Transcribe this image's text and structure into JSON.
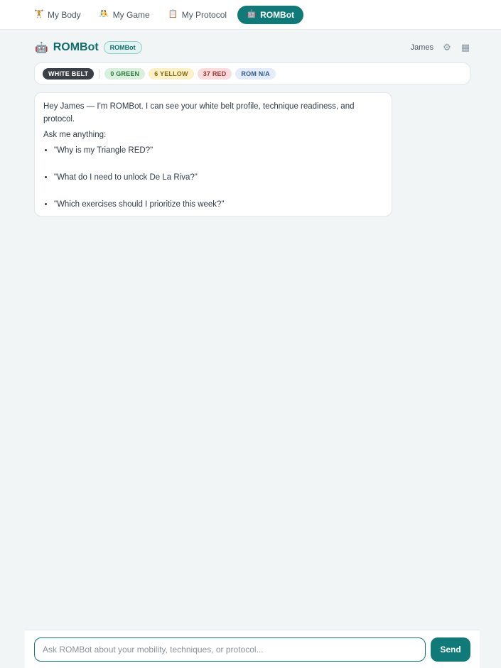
{
  "nav": {
    "tabs": [
      {
        "label": "My Body",
        "icon": "🏋"
      },
      {
        "label": "My Game",
        "icon": "🤼"
      },
      {
        "label": "My Protocol",
        "icon": "📋"
      },
      {
        "label": "ROMBot",
        "icon": "🤖",
        "active": true
      }
    ]
  },
  "header": {
    "icon": "🤖",
    "title": "ROMBot",
    "badge": "ROMBot",
    "user": "James",
    "settings_icon": "⚙",
    "menu_icon": "▦"
  },
  "status": {
    "belt": "WHITE BELT",
    "green": "0 GREEN",
    "yellow": "6 YELLOW",
    "red": "37 RED",
    "rom": "ROM N/A"
  },
  "message": {
    "intro": "Hey James — I'm ROMBot. I can see your white belt profile, technique readiness, and protocol.",
    "prompt": "Ask me anything:",
    "suggestions": [
      "\"Why is my Triangle RED?\"",
      "\"What do I need to unlock De La Riva?\"",
      "\"Which exercises should I prioritize this week?\""
    ]
  },
  "composer": {
    "placeholder": "Ask ROMBot about your mobility, techniques, or protocol...",
    "send_label": "Send"
  },
  "colors": {
    "accent": "#0f7a78",
    "background": "#f1f5f6"
  }
}
